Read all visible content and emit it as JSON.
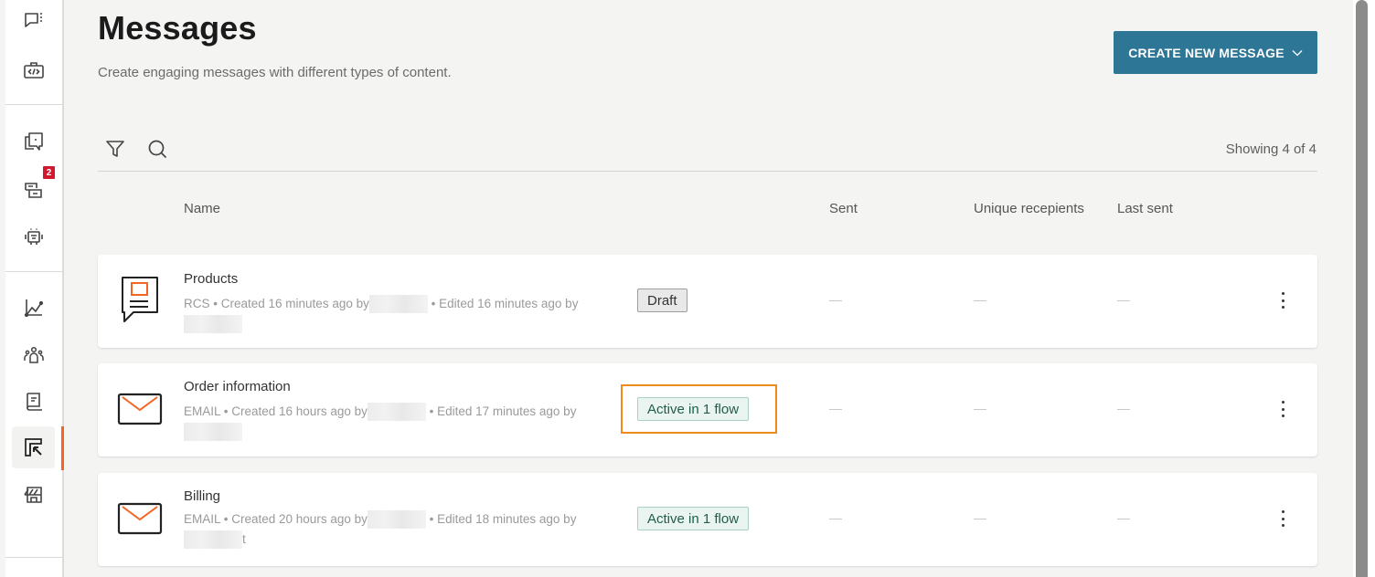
{
  "sidebar": {
    "items": [
      {
        "id": "conversations",
        "icon": "chat-bubble-dots-icon",
        "badge": null,
        "active": false
      },
      {
        "id": "developer",
        "icon": "code-briefcase-icon",
        "badge": null,
        "active": false
      },
      {
        "id": "inbox",
        "icon": "chat-copy-icon",
        "badge": null,
        "active": false
      },
      {
        "id": "tasks",
        "icon": "stacked-cards-icon",
        "badge": "2",
        "active": false
      },
      {
        "id": "bots",
        "icon": "robot-icon",
        "badge": null,
        "active": false
      },
      {
        "id": "analytics",
        "icon": "line-chart-icon",
        "badge": null,
        "active": false
      },
      {
        "id": "people",
        "icon": "people-group-icon",
        "badge": null,
        "active": false
      },
      {
        "id": "docs",
        "icon": "book-icon",
        "badge": null,
        "active": false
      },
      {
        "id": "campaigns",
        "icon": "layout-cursor-icon",
        "badge": null,
        "active": true
      },
      {
        "id": "store",
        "icon": "storefront-icon",
        "badge": null,
        "active": false
      }
    ],
    "accent": "#f26522",
    "badge_color": "#d0192f"
  },
  "header": {
    "title": "Messages",
    "subtitle": "Create engaging messages with different types of content.",
    "create_button_label": "CREATE NEW MESSAGE",
    "create_button_color": "#2e7696"
  },
  "toolbar": {
    "filter_icon": "filter-icon",
    "search_icon": "search-icon",
    "showing_text": "Showing 4 of 4"
  },
  "table": {
    "columns": [
      "Name",
      "Sent",
      "Unique recepients",
      "Last sent"
    ],
    "rows": [
      {
        "name": "Products",
        "type_icon": "rcs-message-icon",
        "channel": "RCS",
        "created": "Created 16 minutes ago by",
        "edited": "Edited 16 minutes ago by",
        "trailing": "",
        "status": "Draft",
        "status_kind": "draft",
        "sent": "—",
        "unique_recipients": "—",
        "last_sent": "—",
        "highlighted": false
      },
      {
        "name": "Order information",
        "type_icon": "envelope-icon",
        "channel": "EMAIL",
        "created": "Created 16 hours ago by",
        "edited": "Edited 17 minutes ago by",
        "trailing": "",
        "status": "Active in 1 flow",
        "status_kind": "active",
        "sent": "—",
        "unique_recipients": "—",
        "last_sent": "—",
        "highlighted": true
      },
      {
        "name": "Billing",
        "type_icon": "envelope-icon",
        "channel": "EMAIL",
        "created": "Created 20 hours ago by",
        "edited": "Edited 18 minutes ago by",
        "trailing": "t",
        "status": "Active in 1 flow",
        "status_kind": "active",
        "sent": "—",
        "unique_recipients": "—",
        "last_sent": "—",
        "highlighted": false
      }
    ]
  }
}
